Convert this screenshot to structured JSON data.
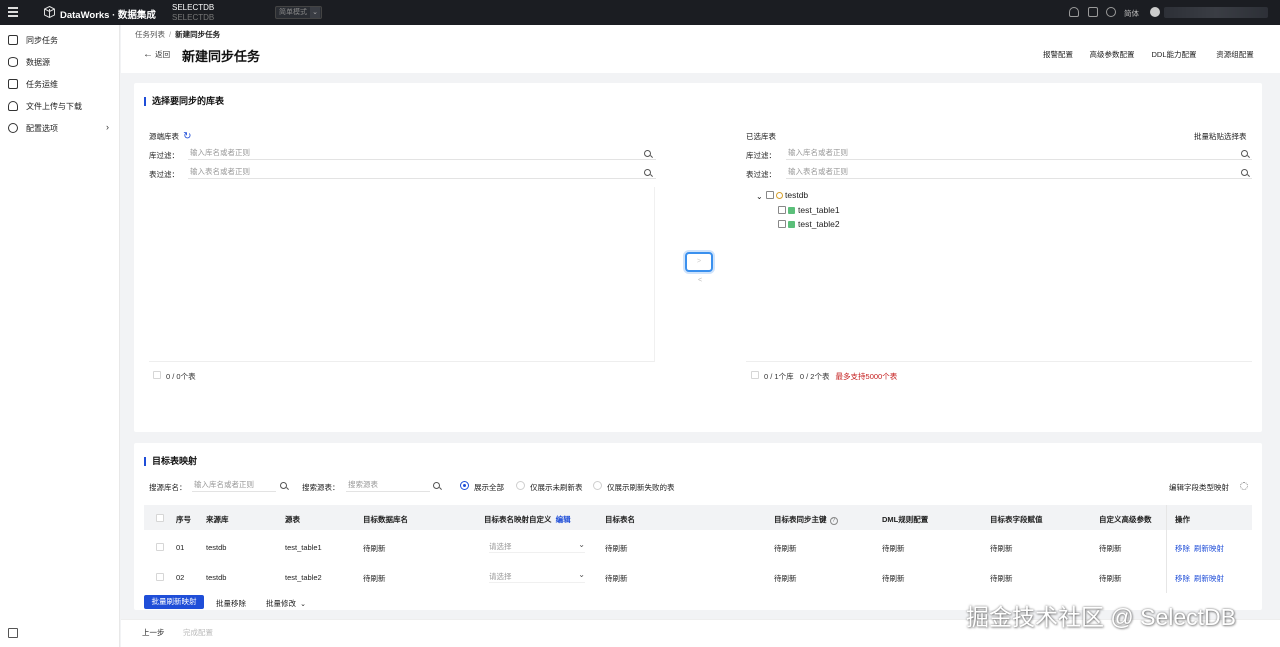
{
  "topbar": {
    "product": "DataWorks · 数据集成",
    "db_name": "SELECTDB",
    "db_type": "SELECTDB",
    "mode": "简单模式",
    "language": "简体"
  },
  "sidebar": {
    "items": [
      {
        "label": "同步任务",
        "icon": "sync-icon"
      },
      {
        "label": "数据源",
        "icon": "datasource-icon"
      },
      {
        "label": "任务运维",
        "icon": "ops-icon"
      },
      {
        "label": "文件上传与下载",
        "icon": "cloud-icon"
      },
      {
        "label": "配置选项",
        "icon": "settings-icon"
      }
    ]
  },
  "header": {
    "breadcrumb_root": "任务列表",
    "breadcrumb_current": "新建同步任务",
    "back_label": "返回",
    "title": "新建同步任务",
    "buttons": [
      "报警配置",
      "高级参数配置",
      "DDL能力配置",
      "资源组配置"
    ]
  },
  "select_tables": {
    "title": "选择要同步的库表",
    "source_label": "源端库表",
    "db_filter_label": "库过滤：",
    "table_filter_label": "表过滤：",
    "db_placeholder": "输入库名或者正则",
    "table_placeholder": "输入表名或者正则",
    "source_count": "0 / 0个表",
    "selected_label": "已选库表",
    "batch_paste": "批量粘贴选择表",
    "selected_db_count": "0 / 1个库",
    "selected_table_count": "0 / 2个表",
    "max_hint": "最多支持5000个表",
    "tree": {
      "db": "testdb",
      "tables": [
        "test_table1",
        "test_table2"
      ]
    },
    "transfer_right": ">",
    "transfer_left": "<"
  },
  "mapping": {
    "title": "目标表映射",
    "search_db_label": "搜源库名：",
    "search_db_placeholder": "输入库名或者正则",
    "search_table_label": "搜索源表：",
    "search_table_placeholder": "搜索源表",
    "radios": [
      "展示全部",
      "仅展示未刷新表",
      "仅展示刷新失败的表"
    ],
    "edit_field_mapping": "编辑字段类型映射",
    "columns": {
      "index": "序号",
      "source_db": "来源库",
      "source_table": "源表",
      "target_db": "目标数据库名",
      "name_rule": "目标表名映射自定义",
      "name_rule_edit": "编辑",
      "target_table": "目标表名",
      "primary_key": "目标表同步主键",
      "dml": "DML规则配置",
      "field_value": "目标表字段赋值",
      "custom_params": "自定义高级参数",
      "ops": "操作"
    },
    "rows": [
      {
        "index": "01",
        "source_db": "testdb",
        "source_table": "test_table1",
        "target_db": "待刷新",
        "name_rule": "请选择",
        "target_table": "待刷新",
        "primary_key": "待刷新",
        "dml": "待刷新",
        "field_value": "待刷新",
        "custom_params": "待刷新",
        "op_remove": "移除",
        "op_refresh": "刷新映射"
      },
      {
        "index": "02",
        "source_db": "testdb",
        "source_table": "test_table2",
        "target_db": "待刷新",
        "name_rule": "请选择",
        "target_table": "待刷新",
        "primary_key": "待刷新",
        "dml": "待刷新",
        "field_value": "待刷新",
        "custom_params": "待刷新",
        "op_remove": "移除",
        "op_refresh": "刷新映射"
      }
    ],
    "batch_refresh": "批量刷新映射",
    "batch_remove": "批量移除",
    "batch_modify": "批量修改"
  },
  "footer": {
    "prev": "上一步",
    "finish": "完成配置"
  },
  "watermark": "掘金技术社区 @ SelectDB",
  "colors": {
    "primary": "#1f4ed8",
    "warning": "#c41d1d",
    "topbar": "#1b1d22"
  }
}
